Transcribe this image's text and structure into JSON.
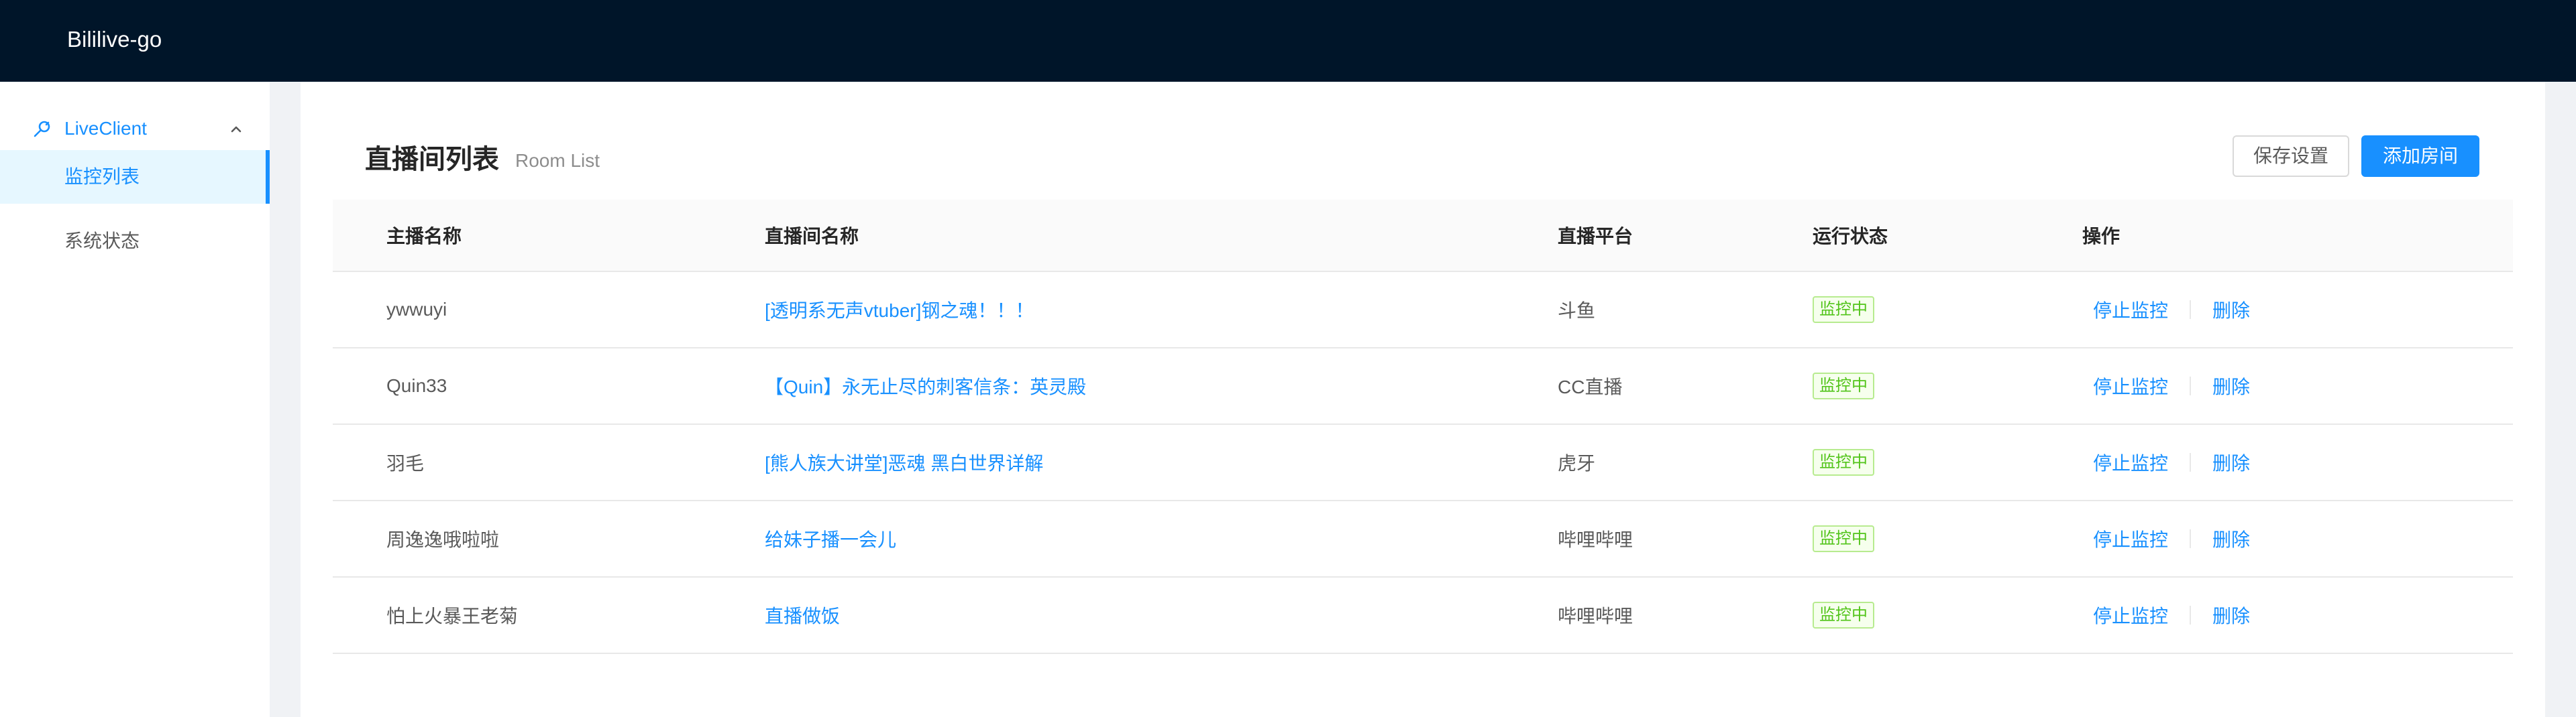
{
  "app": {
    "title": "Bililive-go"
  },
  "sidebar": {
    "group": {
      "label": "LiveClient",
      "icon": "api-icon",
      "expanded": true
    },
    "items": [
      {
        "label": "监控列表",
        "active": true
      },
      {
        "label": "系统状态",
        "active": false
      }
    ]
  },
  "page": {
    "title": "直播间列表",
    "subtitle": "Room List",
    "save_button": "保存设置",
    "add_button": "添加房间"
  },
  "table": {
    "columns": [
      "主播名称",
      "直播间名称",
      "直播平台",
      "运行状态",
      "操作"
    ],
    "rows": [
      {
        "host": "ywwuyi",
        "room": "[透明系无声vtuber]钢之魂！！！",
        "platform": "斗鱼",
        "status": "监控中",
        "action_stop": "停止监控",
        "action_delete": "删除"
      },
      {
        "host": "Quin33",
        "room": "【Quin】永无止尽的刺客信条：英灵殿",
        "platform": "CC直播",
        "status": "监控中",
        "action_stop": "停止监控",
        "action_delete": "删除"
      },
      {
        "host": "羽毛",
        "room": "[熊人族大讲堂]恶魂 黑白世界详解",
        "platform": "虎牙",
        "status": "监控中",
        "action_stop": "停止监控",
        "action_delete": "删除"
      },
      {
        "host": "周逸逸哦啦啦",
        "room": "给妹子播一会儿",
        "platform": "哔哩哔哩",
        "status": "监控中",
        "action_stop": "停止监控",
        "action_delete": "删除"
      },
      {
        "host": "怕上火暴王老菊",
        "room": "直播做饭",
        "platform": "哔哩哔哩",
        "status": "监控中",
        "action_stop": "停止监控",
        "action_delete": "删除"
      }
    ]
  },
  "colors": {
    "header_bg": "#001529",
    "accent": "#1890ff",
    "status_green": "#52c41a"
  }
}
